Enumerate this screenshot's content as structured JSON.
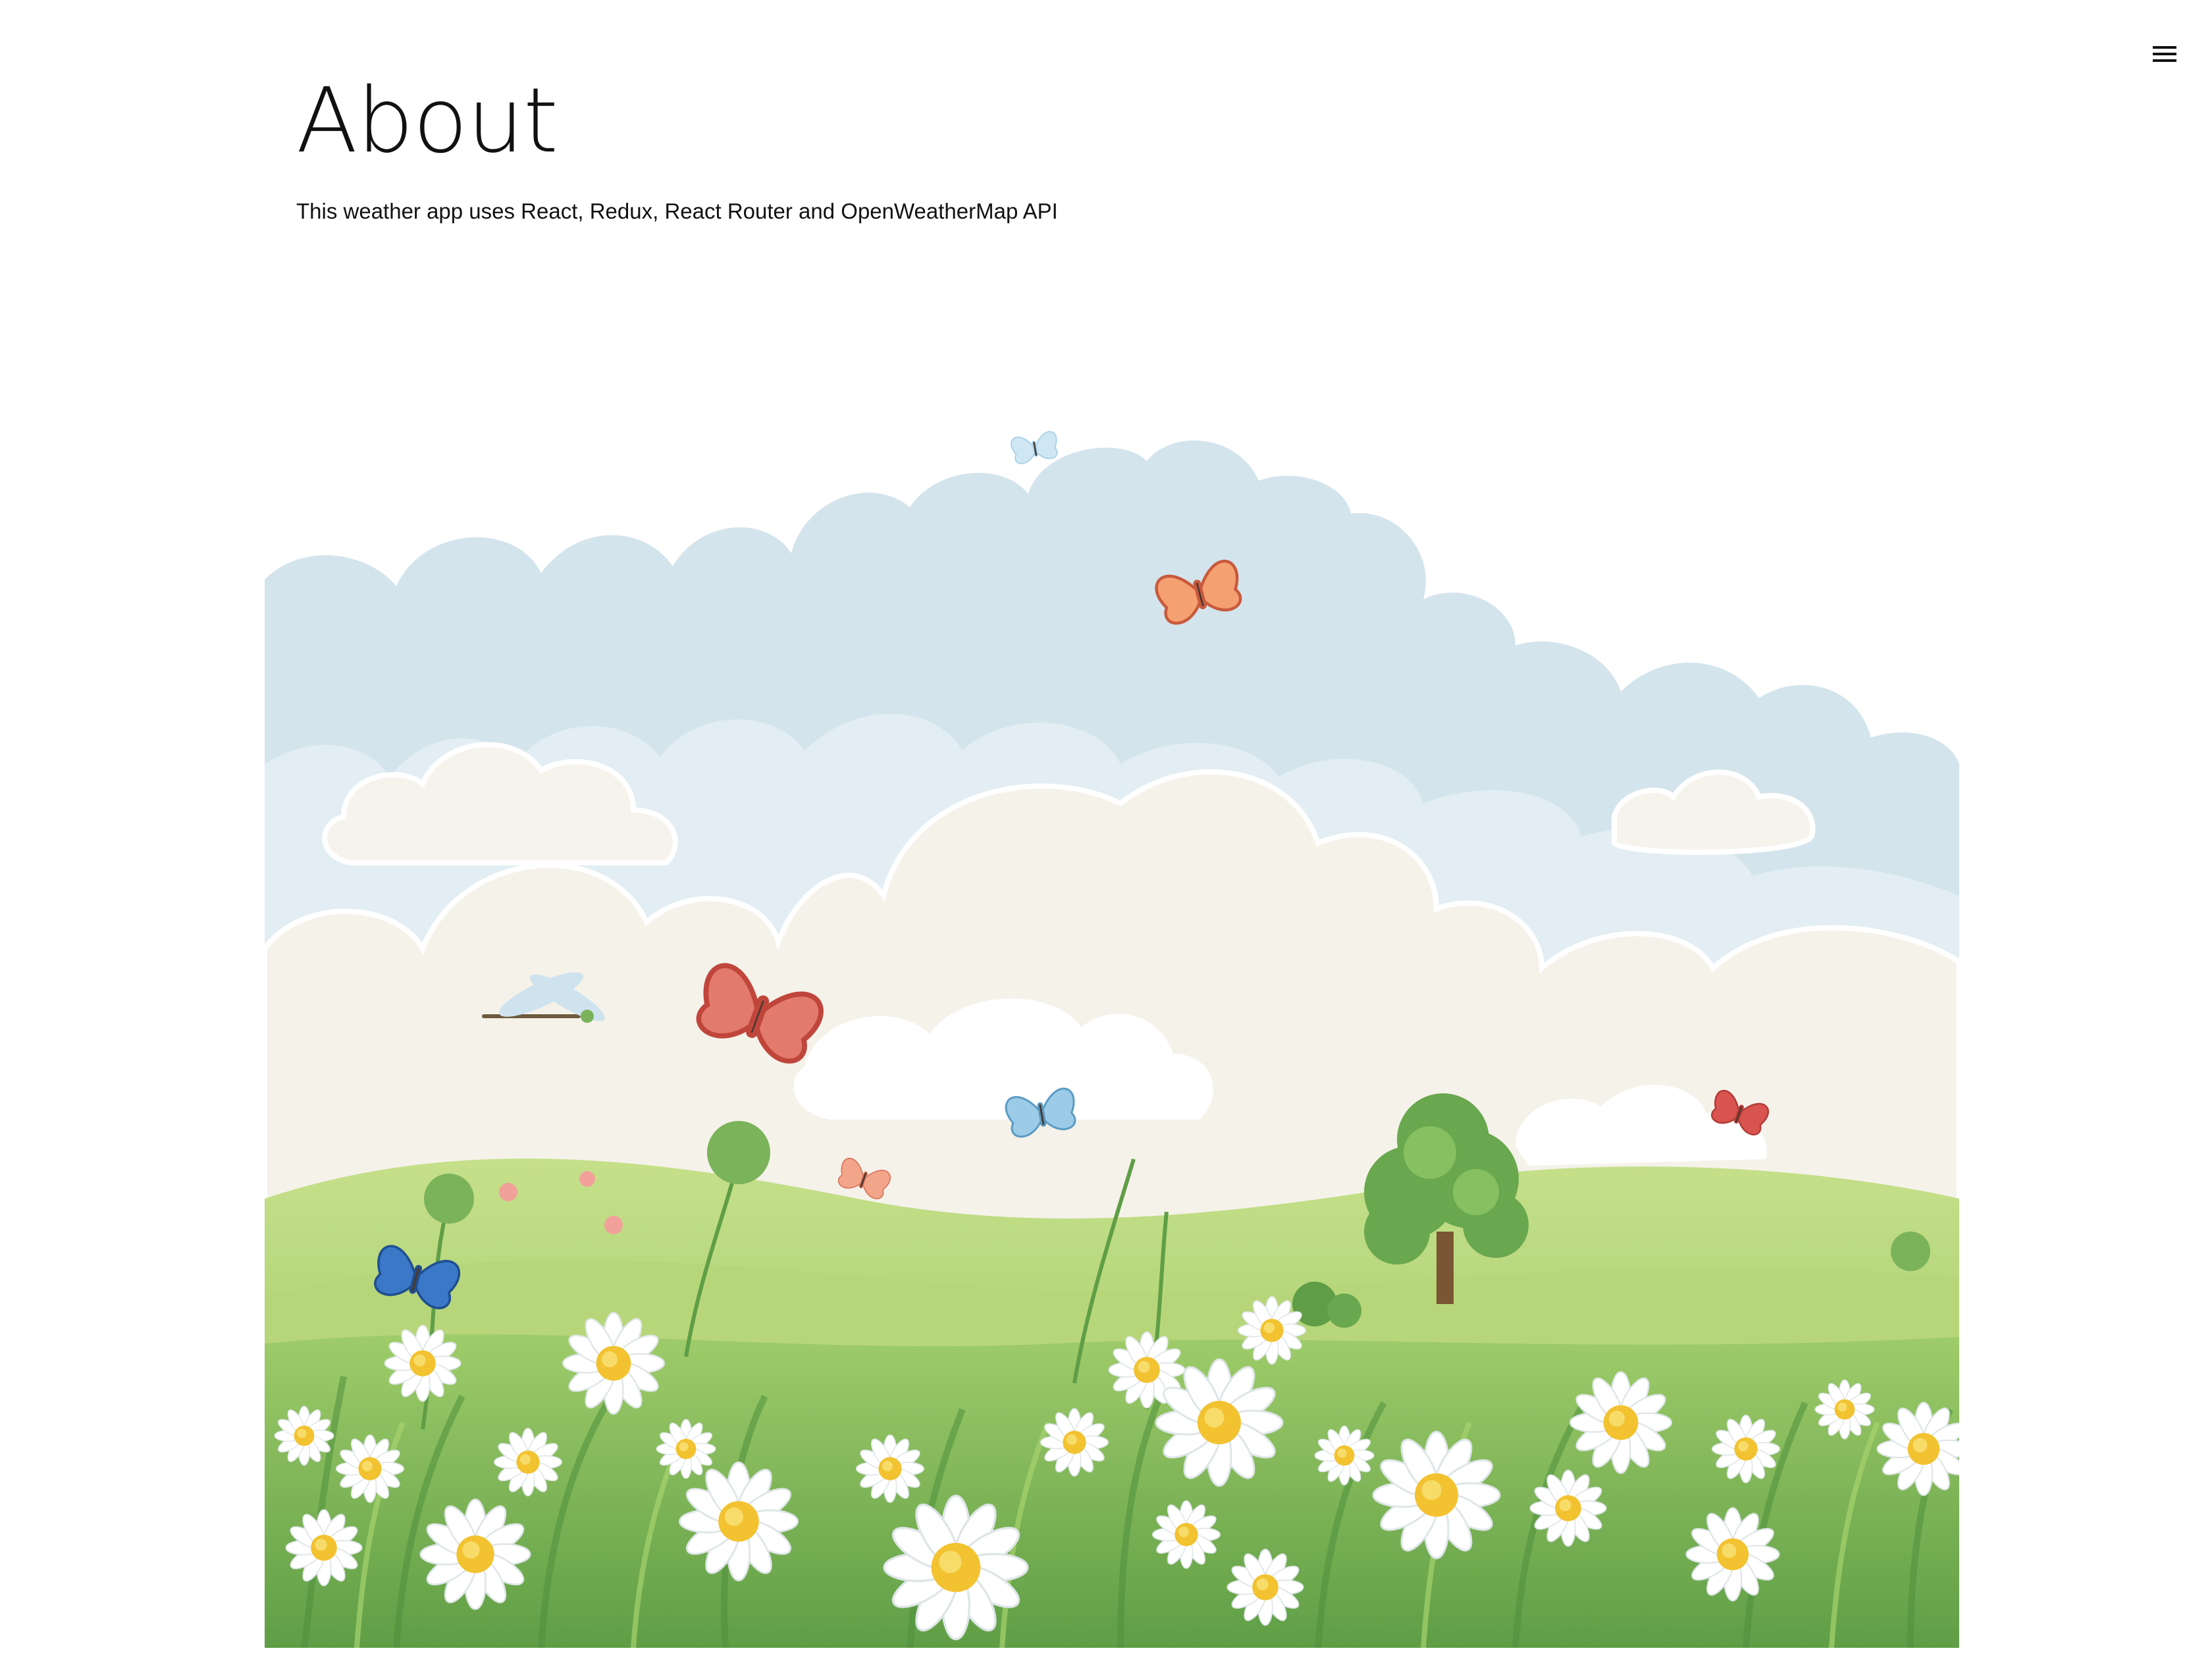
{
  "header": {
    "menu_icon": "hamburger-menu-icon"
  },
  "page": {
    "title": "About",
    "description": "This weather app uses React, Redux, React Router and OpenWeatherMap API"
  },
  "illustration": {
    "subject": "summer-meadow-illustration",
    "colors": {
      "sky": "#d5e5ee",
      "cloud_light": "#f5f2ea",
      "grass_light": "#a9cf6a",
      "grass_dark": "#6aa84f",
      "daisy_petal": "#ffffff",
      "daisy_center": "#f2c230",
      "butterfly_red": "#d9534f",
      "butterfly_blue": "#3b78c8"
    }
  }
}
